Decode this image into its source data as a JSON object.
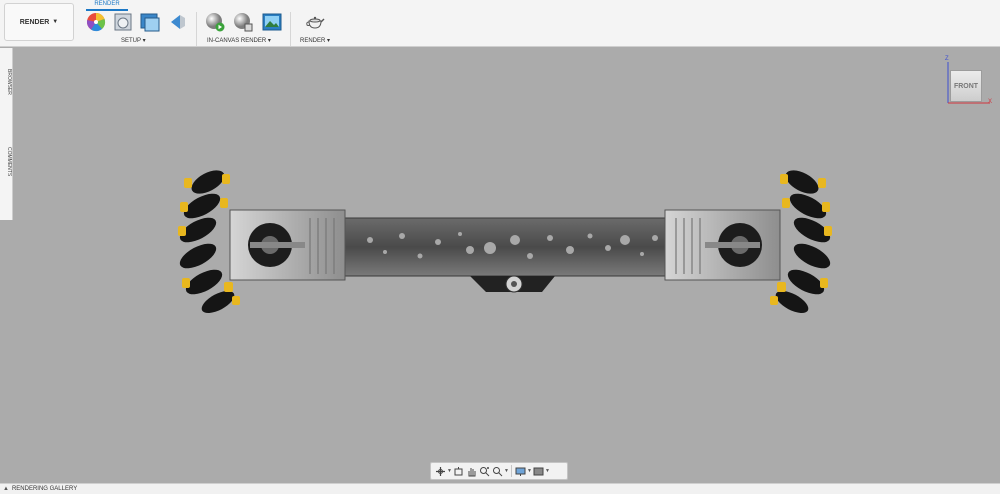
{
  "toolbar": {
    "workspace_label": "RENDER",
    "active_tab": "RENDER",
    "groups": [
      {
        "label": "SETUP ▾"
      },
      {
        "label": "IN-CANVAS RENDER ▾"
      },
      {
        "label": "RENDER ▾"
      }
    ]
  },
  "side_panel": {
    "tabs": [
      "BROWSER",
      "COMMENTS"
    ]
  },
  "viewcube": {
    "face_label": "FRONT",
    "axis_z": "Z",
    "axis_x": "X"
  },
  "bottom_bar": {
    "label": "RENDERING GALLERY"
  },
  "colors": {
    "canvas": "#ababab",
    "toolbar": "#f4f4f4",
    "accent": "#1b78c6",
    "wheel_yellow": "#e8b71f",
    "roller_black": "#151515",
    "frame_gray": "#5c5c5c"
  },
  "icons": {
    "appearance": "color-wheel-icon",
    "scene_settings": "scene-settings-icon",
    "environment": "environment-library-icon",
    "decal": "decal-icon",
    "in_canvas_render": "render-sphere-play-icon",
    "in_canvas_settings": "render-sphere-settings-icon",
    "capture_image": "capture-image-icon",
    "render": "teapot-icon"
  }
}
